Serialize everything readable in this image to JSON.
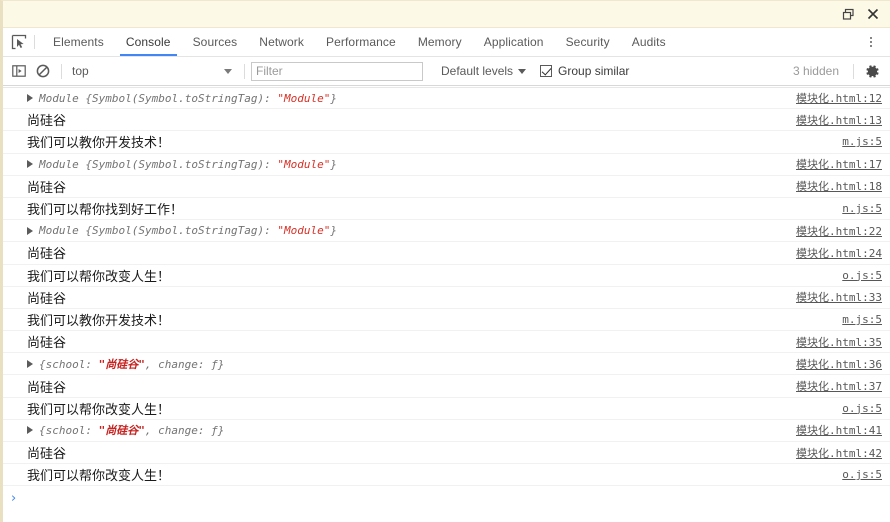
{
  "titlebar": {
    "undock_icon": "undock-window-icon",
    "close_icon": "close-icon"
  },
  "tabs": {
    "inspect_icon": "inspect-element-icon",
    "items": [
      {
        "label": "Elements",
        "active": false
      },
      {
        "label": "Console",
        "active": true
      },
      {
        "label": "Sources",
        "active": false
      },
      {
        "label": "Network",
        "active": false
      },
      {
        "label": "Performance",
        "active": false
      },
      {
        "label": "Memory",
        "active": false
      },
      {
        "label": "Application",
        "active": false
      },
      {
        "label": "Security",
        "active": false
      },
      {
        "label": "Audits",
        "active": false
      }
    ],
    "more_icon": "kebab-menu-icon"
  },
  "toolbar": {
    "sidebar_icon": "console-sidebar-icon",
    "clear_icon": "clear-console-icon",
    "context": "top",
    "filter_placeholder": "Filter",
    "filter_value": "",
    "levels_label": "Default levels",
    "group_similar_label": "Group similar",
    "group_similar_checked": true,
    "hidden_label": "3 hidden",
    "settings_icon": "gear-icon"
  },
  "console": {
    "prompt": "›",
    "rows": [
      {
        "kind": "object",
        "expandable": true,
        "pre": "Module ",
        "body": "{Symbol(Symbol.toStringTag): ",
        "value": "\"Module\"",
        "post": "}",
        "source": "模块化.html:12"
      },
      {
        "kind": "text",
        "expandable": false,
        "text": "尚硅谷",
        "source": "模块化.html:13"
      },
      {
        "kind": "text",
        "expandable": false,
        "text": "我们可以教你开发技术！",
        "source": "m.js:5"
      },
      {
        "kind": "object",
        "expandable": true,
        "pre": "Module ",
        "body": "{Symbol(Symbol.toStringTag): ",
        "value": "\"Module\"",
        "post": "}",
        "source": "模块化.html:17"
      },
      {
        "kind": "text",
        "expandable": false,
        "text": "尚硅谷",
        "source": "模块化.html:18"
      },
      {
        "kind": "text",
        "expandable": false,
        "text": "我们可以帮你找到好工作！",
        "source": "n.js:5"
      },
      {
        "kind": "object",
        "expandable": true,
        "pre": "Module ",
        "body": "{Symbol(Symbol.toStringTag): ",
        "value": "\"Module\"",
        "post": "}",
        "source": "模块化.html:22"
      },
      {
        "kind": "text",
        "expandable": false,
        "text": "尚硅谷",
        "source": "模块化.html:24"
      },
      {
        "kind": "text",
        "expandable": false,
        "text": "我们可以帮你改变人生！",
        "source": "o.js:5"
      },
      {
        "kind": "text",
        "expandable": false,
        "text": "尚硅谷",
        "source": "模块化.html:33"
      },
      {
        "kind": "text",
        "expandable": false,
        "text": "我们可以教你开发技术！",
        "source": "m.js:5"
      },
      {
        "kind": "text",
        "expandable": false,
        "text": "尚硅谷",
        "source": "模块化.html:35"
      },
      {
        "kind": "schoolobj",
        "expandable": true,
        "pre": "{school: ",
        "value": "\"尚硅谷\"",
        "post": ", change: ƒ}",
        "source": "模块化.html:36"
      },
      {
        "kind": "text",
        "expandable": false,
        "text": "尚硅谷",
        "source": "模块化.html:37"
      },
      {
        "kind": "text",
        "expandable": false,
        "text": "我们可以帮你改变人生！",
        "source": "o.js:5"
      },
      {
        "kind": "schoolobj",
        "expandable": true,
        "pre": "{school: ",
        "value": "\"尚硅谷\"",
        "post": ", change: ƒ}",
        "source": "模块化.html:41"
      },
      {
        "kind": "text",
        "expandable": false,
        "text": "尚硅谷",
        "source": "模块化.html:42"
      },
      {
        "kind": "text",
        "expandable": false,
        "text": "我们可以帮你改变人生！",
        "source": "o.js:5"
      }
    ]
  },
  "colors": {
    "accent": "#4285f4",
    "string_red": "#d93025",
    "titlebar_bg": "#fdf9e7",
    "left_border": "#e8e0c0"
  }
}
